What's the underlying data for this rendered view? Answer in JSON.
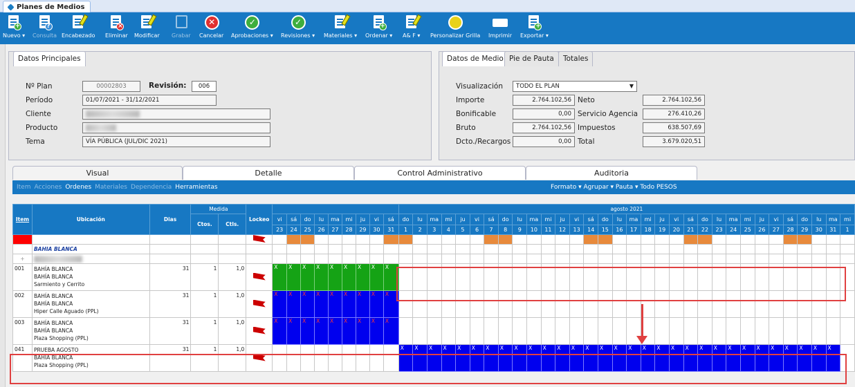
{
  "app_tab": "Planes de Medios",
  "toolbar": [
    {
      "label": "Nuevo ▾",
      "icon": "new-doc-icon",
      "enabled": true
    },
    {
      "label": "Consulta",
      "icon": "query-doc-icon",
      "enabled": false
    },
    {
      "label": "Encabezado",
      "icon": "header-edit-icon",
      "enabled": true
    },
    {
      "label": "Eliminar",
      "icon": "delete-doc-icon",
      "enabled": true
    },
    {
      "label": "Modificar",
      "icon": "modify-doc-icon",
      "enabled": true
    },
    {
      "label": "Grabar",
      "icon": "save-icon",
      "enabled": false
    },
    {
      "label": "Cancelar",
      "icon": "cancel-icon",
      "enabled": true
    },
    {
      "label": "Aprobaciones ▾",
      "icon": "approve-icon",
      "enabled": true
    },
    {
      "label": "Revisiones ▾",
      "icon": "review-icon",
      "enabled": true
    },
    {
      "label": "Materiales ▾",
      "icon": "materials-icon",
      "enabled": true
    },
    {
      "label": "Ordenar ▾",
      "icon": "order-icon",
      "enabled": true
    },
    {
      "label": "A& F ▾",
      "icon": "af-icon",
      "enabled": true
    },
    {
      "label": "Personalizar Grilla",
      "icon": "customize-grid-icon",
      "enabled": true
    },
    {
      "label": "Imprimir",
      "icon": "printer-icon",
      "enabled": true
    },
    {
      "label": "Exportar ▾",
      "icon": "export-icon",
      "enabled": true
    }
  ],
  "datos": {
    "tab": "Datos Principales",
    "nplan_label": "Nº Plan",
    "nplan": "00002803",
    "revision_label": "Revisión:",
    "revision": "006",
    "periodo_label": "Período",
    "periodo": "01/07/2021 - 31/12/2021",
    "cliente_label": "Cliente",
    "producto_label": "Producto",
    "tema_label": "Tema",
    "tema": "VÍA PÚBLICA (JUL/DIC 2021)"
  },
  "medio": {
    "tabs": [
      "Datos de Medio",
      "Pie de Pauta",
      "Totales"
    ],
    "visualizacion_label": "Visualización",
    "visualizacion": "TODO EL PLAN",
    "importe_label": "Importe",
    "importe": "2.764.102,56",
    "neto_label": "Neto",
    "neto": "2.764.102,56",
    "bonificable_label": "Bonificable",
    "bonificable": "0,00",
    "servicio_label": "Servicio Agencia",
    "servicio": "276.410,26",
    "bruto_label": "Bruto",
    "bruto": "2.764.102,56",
    "impuestos_label": "Impuestos",
    "impuestos": "638.507,69",
    "dcto_label": "Dcto./Recargos",
    "dcto": "0,00",
    "total_label": "Total",
    "total": "3.679.020,51"
  },
  "section_tabs": [
    "Visual",
    "Detalle",
    "Control Administrativo",
    "Auditoria"
  ],
  "subbar": {
    "left": [
      "Item",
      "Acciones",
      "Ordenes",
      "Materiales",
      "Dependencia",
      "Herramientas"
    ],
    "right": "Formato ▾   Agrupar ▾   Pauta ▾   Todo   PESOS"
  },
  "grid": {
    "h_item": "Item",
    "h_ubicacion": "Ubicación",
    "h_dias": "Dias",
    "h_medida": "Medida",
    "h_ctos": "Ctos.",
    "h_ctls": "Ctls.",
    "h_lockeo": "Lockeo",
    "month": "agosto 2021",
    "days_jul": [
      "vi",
      "sá",
      "do",
      "lu",
      "ma",
      "mi",
      "ju",
      "vi",
      "sá"
    ],
    "nums_jul": [
      "23",
      "24",
      "25",
      "26",
      "27",
      "28",
      "29",
      "30",
      "31"
    ],
    "days_aug": [
      "do",
      "lu",
      "ma",
      "mi",
      "ju",
      "vi",
      "sá",
      "do",
      "lu",
      "ma",
      "mi",
      "ju",
      "vi",
      "sá",
      "do",
      "lu",
      "ma",
      "mi",
      "ju",
      "vi",
      "sá",
      "do",
      "lu",
      "ma",
      "mi",
      "ju",
      "vi",
      "sá",
      "do",
      "lu",
      "ma",
      "mi"
    ],
    "nums_aug": [
      "1",
      "2",
      "3",
      "4",
      "5",
      "6",
      "7",
      "8",
      "9",
      "10",
      "11",
      "12",
      "13",
      "14",
      "15",
      "16",
      "17",
      "18",
      "19",
      "20",
      "21",
      "22",
      "23",
      "24",
      "25",
      "26",
      "27",
      "28",
      "29",
      "30",
      "31",
      "1"
    ],
    "group": "BAHIA BLANCA",
    "rows": [
      {
        "item": "001",
        "l1": "BAHÍA BLANCA",
        "l2": "BAHÍA BLANCA",
        "l3": "Sarmiento y Cerrito",
        "dias": "31",
        "ctos": "1",
        "ctls": "1,0"
      },
      {
        "item": "002",
        "l1": "BAHÍA BLANCA",
        "l2": "BAHÍA BLANCA",
        "l3": "Hiper Calle Aguado (PPL)",
        "dias": "31",
        "ctos": "1",
        "ctls": "1,0"
      },
      {
        "item": "003",
        "l1": "BAHÍA BLANCA",
        "l2": "BAHÍA BLANCA",
        "l3": "Plaza Shopping (PPL)",
        "dias": "31",
        "ctos": "1",
        "ctls": "1,0"
      },
      {
        "item": "041",
        "l1": "PRUEBA AGOSTO",
        "l2": "BAHÍA BLANCA",
        "l3": "Plaza Shopping (PPL)",
        "dias": "31",
        "ctos": "1",
        "ctls": "1,0"
      }
    ],
    "mark": "X"
  },
  "colors": {
    "toolbar": "#1778c3",
    "green": "#15a315",
    "blue": "#0000ee",
    "weekend": "#e88a3c",
    "annot": "#e04040"
  }
}
